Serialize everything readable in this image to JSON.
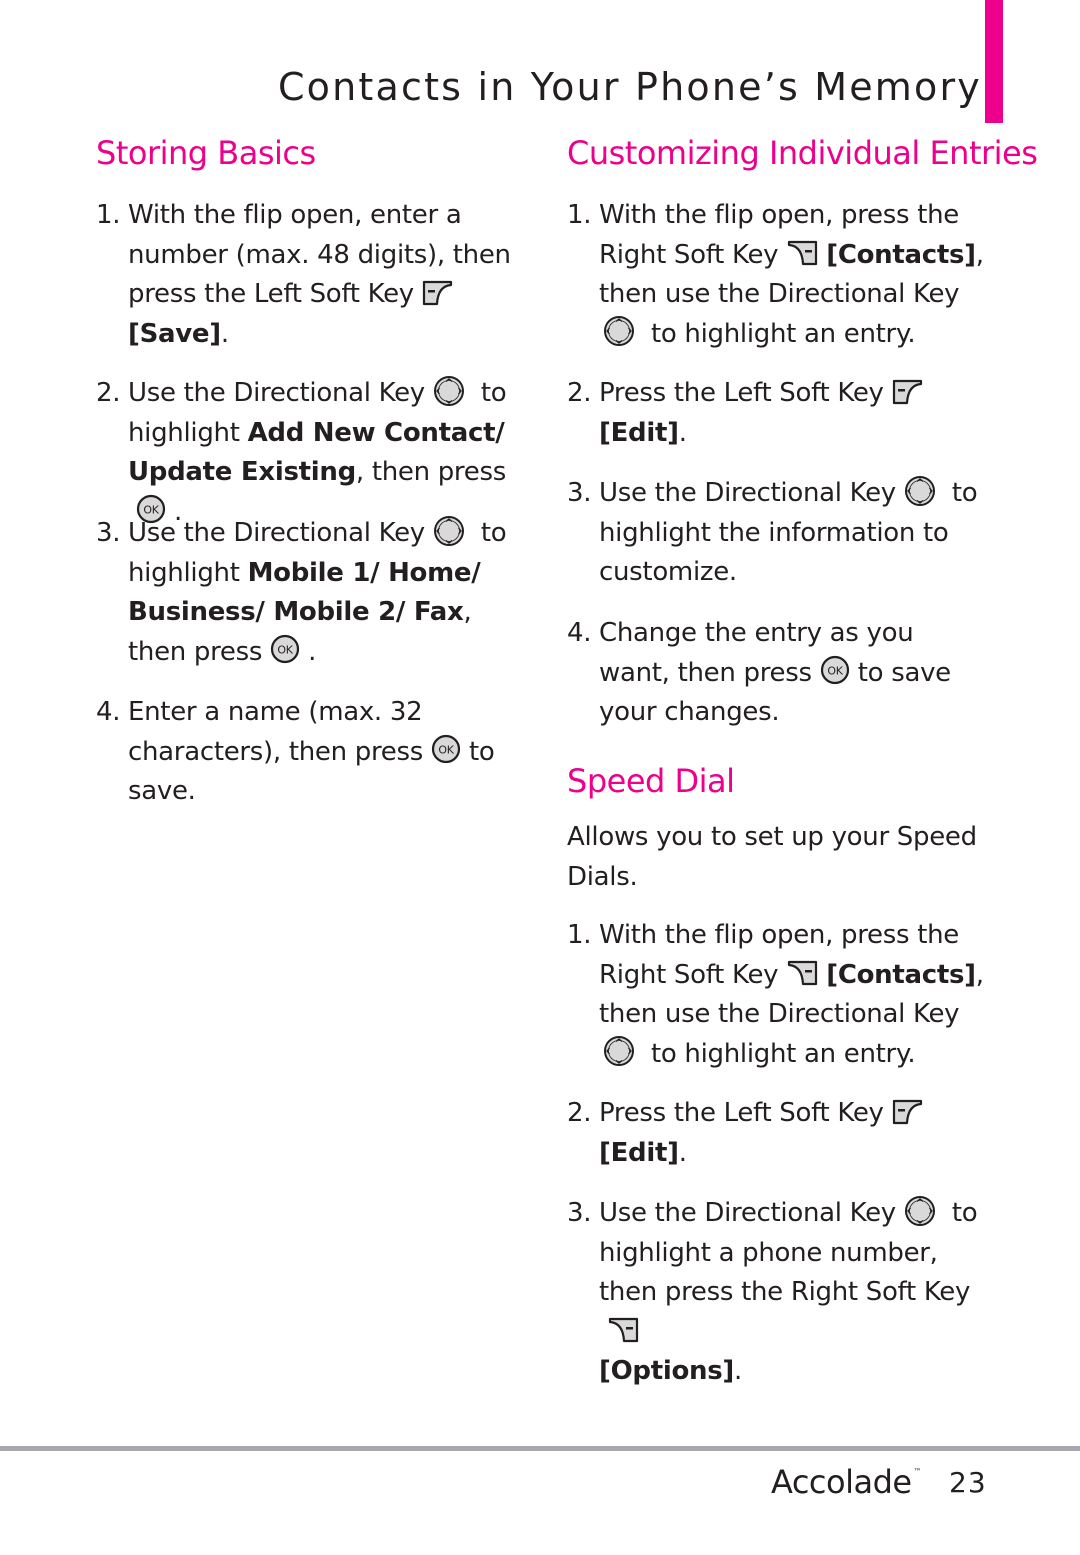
{
  "header": {
    "title": "Contacts in Your Phone’s Memory",
    "accent_color": "#ec008c"
  },
  "left": {
    "heading": "Storing Basics",
    "steps": [
      {
        "num": "1.",
        "t1": "With the flip open, enter a number (max. 48 digits), then press the Left Soft Key",
        "icon": "left-soft-key-icon",
        "b1": "[Save]",
        "t2": "."
      },
      {
        "num": "2.",
        "t1": "Use the Directional Key",
        "icon": "directional-key-icon",
        "t2": "to highlight",
        "b1": "Add New Contact/ Update Existing",
        "t3": ", then press",
        "icon2": "ok-key-icon",
        "t4": "."
      },
      {
        "num": "3.",
        "t1": "Use the Directional Key",
        "icon": "directional-key-icon",
        "t2": "to highlight",
        "b1": "Mobile 1/ Home/ Business/ Mobile 2/ Fax",
        "t3": ", then press",
        "icon2": "ok-key-icon",
        "t4": "."
      },
      {
        "num": "4.",
        "t1": "Enter a name (max. 32 characters), then press",
        "icon": "ok-key-icon",
        "t2": "to save."
      }
    ]
  },
  "right": {
    "customizing": {
      "heading": "Customizing Individual Entries",
      "steps": [
        {
          "num": "1.",
          "t1": "With the flip open, press the Right Soft Key",
          "icon": "right-soft-key-icon",
          "b1": "[Contacts]",
          "t2": ", then use the Directional Key",
          "icon2": "directional-key-icon",
          "t3": "to highlight an entry."
        },
        {
          "num": "2.",
          "t1": "Press the Left Soft Key",
          "icon": "left-soft-key-icon",
          "b1": "[Edit]",
          "t2": "."
        },
        {
          "num": "3.",
          "t1": "Use the Directional Key",
          "icon": "directional-key-icon",
          "t2": "to highlight the information to customize."
        },
        {
          "num": "4.",
          "t1": "Change the entry as you want, then press",
          "icon": "ok-key-icon",
          "t2": "to save your changes."
        }
      ]
    },
    "speed_dial": {
      "heading": "Speed Dial",
      "intro": "Allows you to set up your Speed Dials.",
      "steps": [
        {
          "num": "1.",
          "t1": "With the flip open, press the Right Soft Key",
          "icon": "right-soft-key-icon",
          "b1": "[Contacts]",
          "t2": ", then use the Directional Key",
          "icon2": "directional-key-icon",
          "t3": "to highlight an entry."
        },
        {
          "num": "2.",
          "t1": "Press the Left Soft Key",
          "icon": "left-soft-key-icon",
          "b1": "[Edit]",
          "t2": "."
        },
        {
          "num": "3.",
          "t1": "Use the Directional Key",
          "icon": "directional-key-icon",
          "t2": "to highlight a phone number, then press the Right Soft Key",
          "icon2": "right-soft-key-icon",
          "b1": "[Options]",
          "t3": "."
        }
      ]
    }
  },
  "footer": {
    "brand": "Accolade",
    "trademark": "™",
    "page_number": "23"
  }
}
